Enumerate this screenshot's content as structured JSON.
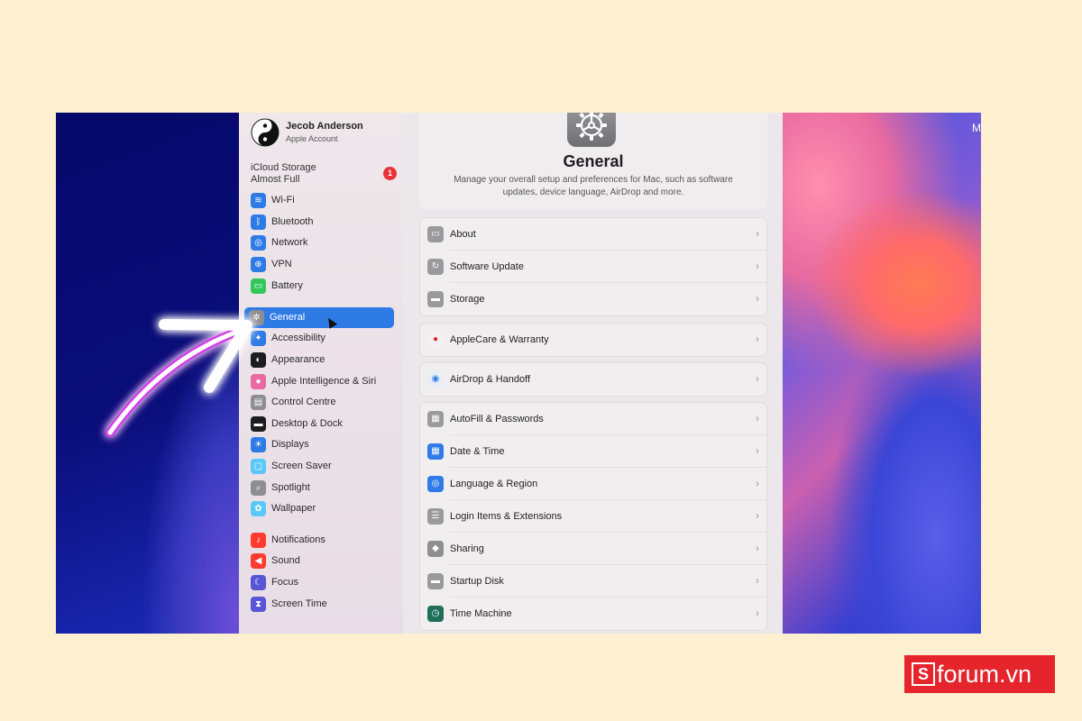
{
  "menubar": {
    "letter": "M"
  },
  "account": {
    "name": "Jecob Anderson",
    "subtitle": "Apple Account"
  },
  "icloud": {
    "line1": "iCloud Storage",
    "line2": "Almost Full",
    "badge": "1"
  },
  "sidebar": {
    "items": [
      {
        "label": "Wi-Fi",
        "icon": "wifi-icon",
        "color": "#2f7be6"
      },
      {
        "label": "Bluetooth",
        "icon": "bluetooth-icon",
        "color": "#2f7be6"
      },
      {
        "label": "Network",
        "icon": "globe-icon",
        "color": "#2f7be6"
      },
      {
        "label": "VPN",
        "icon": "vpn-icon",
        "color": "#2f7be6"
      },
      {
        "label": "Battery",
        "icon": "battery-icon",
        "color": "#34c759"
      },
      {
        "label": "General",
        "icon": "gear-icon",
        "color": "#8e8e93",
        "selected": true
      },
      {
        "label": "Accessibility",
        "icon": "accessibility-icon",
        "color": "#2f7be6"
      },
      {
        "label": "Appearance",
        "icon": "appearance-icon",
        "color": "#1d1d1f"
      },
      {
        "label": "Apple Intelligence & Siri",
        "icon": "siri-icon",
        "color": "#e86aa0"
      },
      {
        "label": "Control Centre",
        "icon": "control-centre-icon",
        "color": "#8e8e93"
      },
      {
        "label": "Desktop & Dock",
        "icon": "dock-icon",
        "color": "#1d1d1f"
      },
      {
        "label": "Displays",
        "icon": "sun-icon",
        "color": "#2f7be6"
      },
      {
        "label": "Screen Saver",
        "icon": "screen-saver-icon",
        "color": "#5ac8fa"
      },
      {
        "label": "Spotlight",
        "icon": "magnifier-icon",
        "color": "#8e8e93"
      },
      {
        "label": "Wallpaper",
        "icon": "flower-icon",
        "color": "#5ac8fa"
      },
      {
        "label": "Notifications",
        "icon": "bell-icon",
        "color": "#ff3b30"
      },
      {
        "label": "Sound",
        "icon": "speaker-icon",
        "color": "#ff3b30"
      },
      {
        "label": "Focus",
        "icon": "moon-icon",
        "color": "#5856d6"
      },
      {
        "label": "Screen Time",
        "icon": "hourglass-icon",
        "color": "#5856d6"
      }
    ]
  },
  "main": {
    "title": "General",
    "description": "Manage your overall setup and preferences for Mac, such as software updates, device language, AirDrop and more.",
    "groups": [
      {
        "rows": [
          {
            "label": "About",
            "icon": "about-icon",
            "color": "#9a9a9e"
          },
          {
            "label": "Software Update",
            "icon": "software-update-icon",
            "color": "#9a9a9e"
          },
          {
            "label": "Storage",
            "icon": "storage-icon",
            "color": "#9a9a9e"
          }
        ]
      },
      {
        "rows": [
          {
            "label": "AppleCare & Warranty",
            "icon": "apple-icon",
            "color": "#f4f0f2"
          }
        ]
      },
      {
        "rows": [
          {
            "label": "AirDrop & Handoff",
            "icon": "airdrop-icon",
            "color": "#e8eef6"
          }
        ]
      },
      {
        "rows": [
          {
            "label": "AutoFill & Passwords",
            "icon": "autofill-icon",
            "color": "#9a9a9e"
          },
          {
            "label": "Date & Time",
            "icon": "calendar-icon",
            "color": "#2f7be6"
          },
          {
            "label": "Language & Region",
            "icon": "globe-icon",
            "color": "#2f7be6"
          },
          {
            "label": "Login Items & Extensions",
            "icon": "list-icon",
            "color": "#9a9a9e"
          },
          {
            "label": "Sharing",
            "icon": "sharing-icon",
            "color": "#8e8e93"
          },
          {
            "label": "Startup Disk",
            "icon": "disk-icon",
            "color": "#9a9a9e"
          },
          {
            "label": "Time Machine",
            "icon": "time-machine-icon",
            "color": "#1f6f5a"
          }
        ]
      }
    ]
  },
  "chevron": "›",
  "logo": {
    "letter": "S",
    "text": "forum.vn",
    "color": "#e5242b"
  }
}
